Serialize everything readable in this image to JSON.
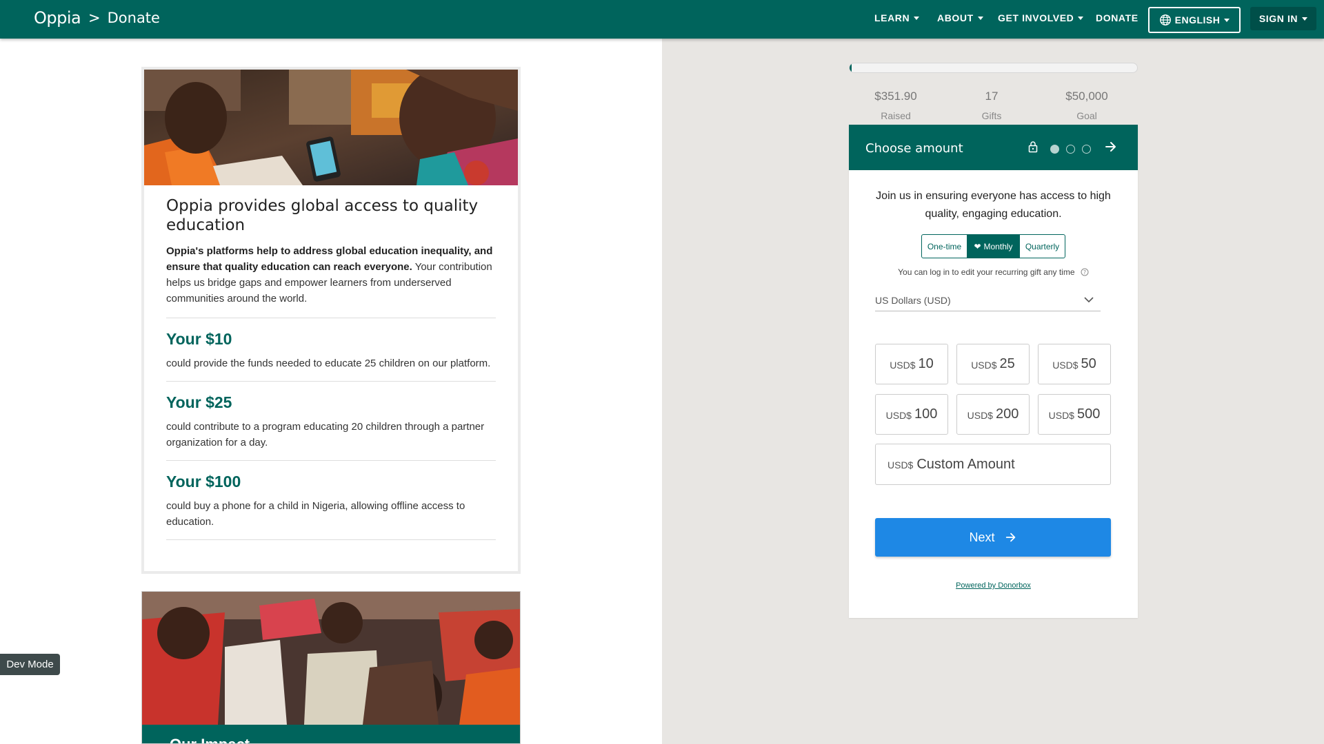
{
  "nav": {
    "logo": "Oppia",
    "crumb_sep": ">",
    "crumb": "Donate",
    "items": [
      "LEARN",
      "ABOUT",
      "GET INVOLVED",
      "DONATE"
    ],
    "language": "ENGLISH",
    "signin": "SIGN IN"
  },
  "card": {
    "title": "Oppia provides global access to quality education",
    "intro_bold": "Oppia's platforms help to address global education inequality, and ensure that quality education can reach everyone.",
    "intro_rest": " Your contribution helps us bridge gaps and empower learners from underserved communities around the world.",
    "impacts": [
      {
        "heading": "Your $10",
        "text": "could provide the funds needed to educate 25 children on our platform."
      },
      {
        "heading": "Your $25",
        "text": "could contribute to a program educating 20 children through a partner organization for a day."
      },
      {
        "heading": "Your $100",
        "text": "could buy a phone for a child in Nigeria, allowing offline access to education."
      }
    ]
  },
  "impact_card": {
    "title": "Our Impact"
  },
  "dev_mode": "Dev Mode",
  "widget": {
    "progress_fraction": 0.007,
    "stats": [
      {
        "value": "$351.90",
        "label": "Raised"
      },
      {
        "value": "17",
        "label": "Gifts"
      },
      {
        "value": "$50,000",
        "label": "Goal"
      }
    ],
    "header_title": "Choose amount",
    "intro": "Join us in ensuring everyone has access to high quality, engaging education.",
    "frequency": {
      "options": [
        "One-time",
        "Monthly",
        "Quarterly"
      ],
      "selected": "Monthly"
    },
    "recurring_note": "You can log in to edit your recurring gift any time",
    "currency": "US Dollars (USD)",
    "currency_prefix": "USD$",
    "amounts": [
      "10",
      "25",
      "50",
      "100",
      "200",
      "500"
    ],
    "custom_placeholder": "Custom Amount",
    "next": "Next",
    "powered_by": "Powered by Donorbox"
  },
  "colors": {
    "brand": "#00645c",
    "button": "#1e88e5",
    "panel_bg": "#e8e6e3"
  }
}
